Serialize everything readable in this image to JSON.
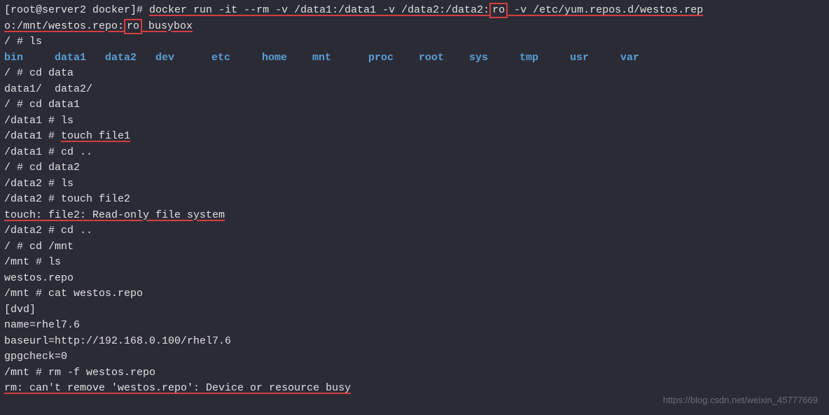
{
  "lines": {
    "prompt_start": "[root@server2 docker]# ",
    "cmd_part1": "docker run -it --rm -v /data1:/data1 -v /data2:/data2:",
    "cmd_ro1": "ro",
    "cmd_part2": " -v /etc/yum.repos.d/westos.rep",
    "cmd_line2_part1": "o:/mnt/westos.repo:",
    "cmd_ro2": "ro",
    "cmd_line2_part2": " busybox",
    "ls1": "/ # ls",
    "cd_data": "/ # cd data",
    "data_dirs": "data1/  data2/",
    "cd_data1": "/ # cd data1",
    "data1_ls": "/data1 # ls",
    "data1_prompt": "/data1 # ",
    "touch_file1": "touch file1",
    "data1_cdup": "/data1 # cd ..",
    "cd_data2": "/ # cd data2",
    "data2_ls": "/data2 # ls",
    "data2_touch": "/data2 # touch file2",
    "readonly_err": "touch: file2: Read-only file system",
    "data2_cdup": "/data2 # cd ..",
    "cd_mnt": "/ # cd /mnt",
    "mnt_ls": "/mnt # ls",
    "westos_repo": "westos.repo",
    "cat_westos": "/mnt # cat westos.repo",
    "dvd": "[dvd]",
    "name_line": "name=rhel7.6",
    "baseurl_line": "baseurl=http://192.168.0.100/rhel7.6",
    "gpgcheck_line": "gpgcheck=0",
    "blank": "",
    "rm_cmd": "/mnt # rm -f westos.repo",
    "rm_err": "rm: can't remove 'westos.repo': Device or resource busy"
  },
  "dirs": [
    "bin",
    "data1",
    "data2",
    "dev",
    "etc",
    "home",
    "mnt",
    "proc",
    "root",
    "sys",
    "tmp",
    "usr",
    "var"
  ],
  "dir_widths": [
    72,
    72,
    72,
    80,
    72,
    72,
    80,
    72,
    72,
    72,
    72,
    72,
    40
  ],
  "watermark": "https://blog.csdn.net/weixin_45777669"
}
